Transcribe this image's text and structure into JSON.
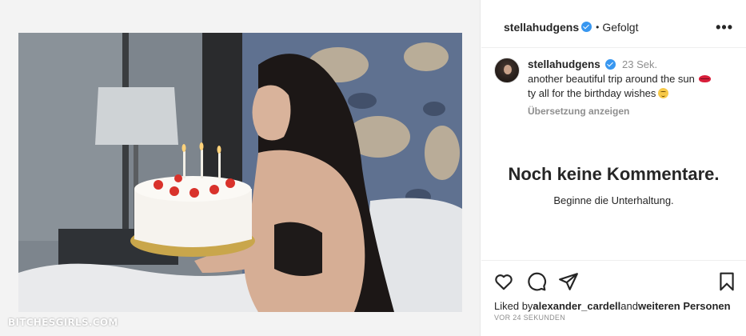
{
  "post": {
    "username": "stellahudgens",
    "follow_status": "Gefolgt",
    "more_icon": "more-icon",
    "caption": {
      "username": "stellahudgens",
      "time": "23 Sek.",
      "line1": "another beautiful trip around the sun",
      "line2": "ty all for the birthday wishes",
      "translate": "Übersetzung anzeigen"
    },
    "comments": {
      "empty_title": "Noch keine Kommentare.",
      "empty_sub": "Beginne die Unterhaltung."
    },
    "likes": {
      "prefix": "Liked by",
      "user": "alexander_cardell",
      "and": "and",
      "others": "weiteren Personen"
    },
    "posted_ago": "VOR 24 SEKUNDEN"
  },
  "watermark": "BITCHESGIRLS.COM",
  "colors": {
    "verified": "#3897f0",
    "text": "#262626",
    "muted": "#8e8e8e"
  }
}
